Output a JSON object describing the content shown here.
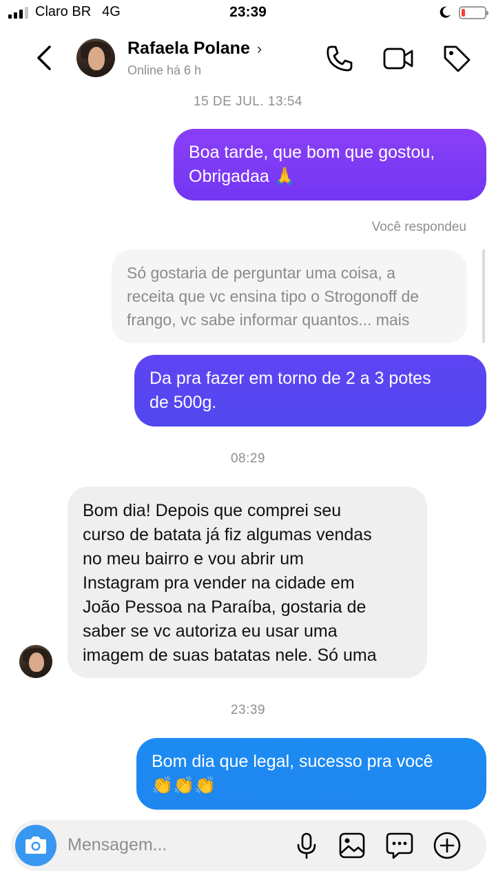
{
  "status_bar": {
    "carrier": "Claro BR",
    "network": "4G",
    "time": "23:39"
  },
  "header": {
    "name": "Rafaela Polane",
    "chevron": "›",
    "status": "Online há 6 h",
    "icons": [
      "back-chevron-icon",
      "phone-icon",
      "video-camera-icon",
      "tag-icon"
    ]
  },
  "thread": {
    "ts1": "15 DE JUL. 13:54",
    "msg1": {
      "line1": "Boa tarde, que bom que gostou,",
      "line2": "Obrigadaa 🙏"
    },
    "replied_label": "Você respondeu",
    "quoted": {
      "line1": "Só gostaria de perguntar uma coisa, a",
      "line2": "receita que vc ensina tipo o Strogonoff de",
      "line3": "frango, vc sabe informar quantos... mais"
    },
    "msg2": {
      "line1": "Da pra fazer em torno de 2 a 3 potes",
      "line2": "de 500g."
    },
    "ts2": "08:29",
    "msg3": {
      "line1": "Bom dia! Depois que comprei seu",
      "line2": "curso de batata já fiz algumas vendas",
      "line3": "no meu bairro e vou abrir um",
      "line4": "Instagram pra vender na cidade em",
      "line5": "João Pessoa na Paraíba, gostaria de",
      "line6": "saber se vc autoriza eu usar uma",
      "line7": "imagem de suas batatas nele. Só uma"
    },
    "ts3": "23:39",
    "msg4": {
      "line1": "Bom dia que legal, sucesso pra você",
      "line2": "👏👏👏"
    }
  },
  "composer": {
    "placeholder": "Mensagem...",
    "icons": [
      "camera-icon",
      "microphone-icon",
      "gallery-icon",
      "sticker-icon",
      "add-icon"
    ]
  },
  "colors": {
    "outgoing_purple": "#7a3cf5",
    "outgoing_indigo": "#5b45f0",
    "outgoing_blue": "#1e88f0",
    "incoming": "#efefef",
    "camera_button": "#3897f0"
  }
}
